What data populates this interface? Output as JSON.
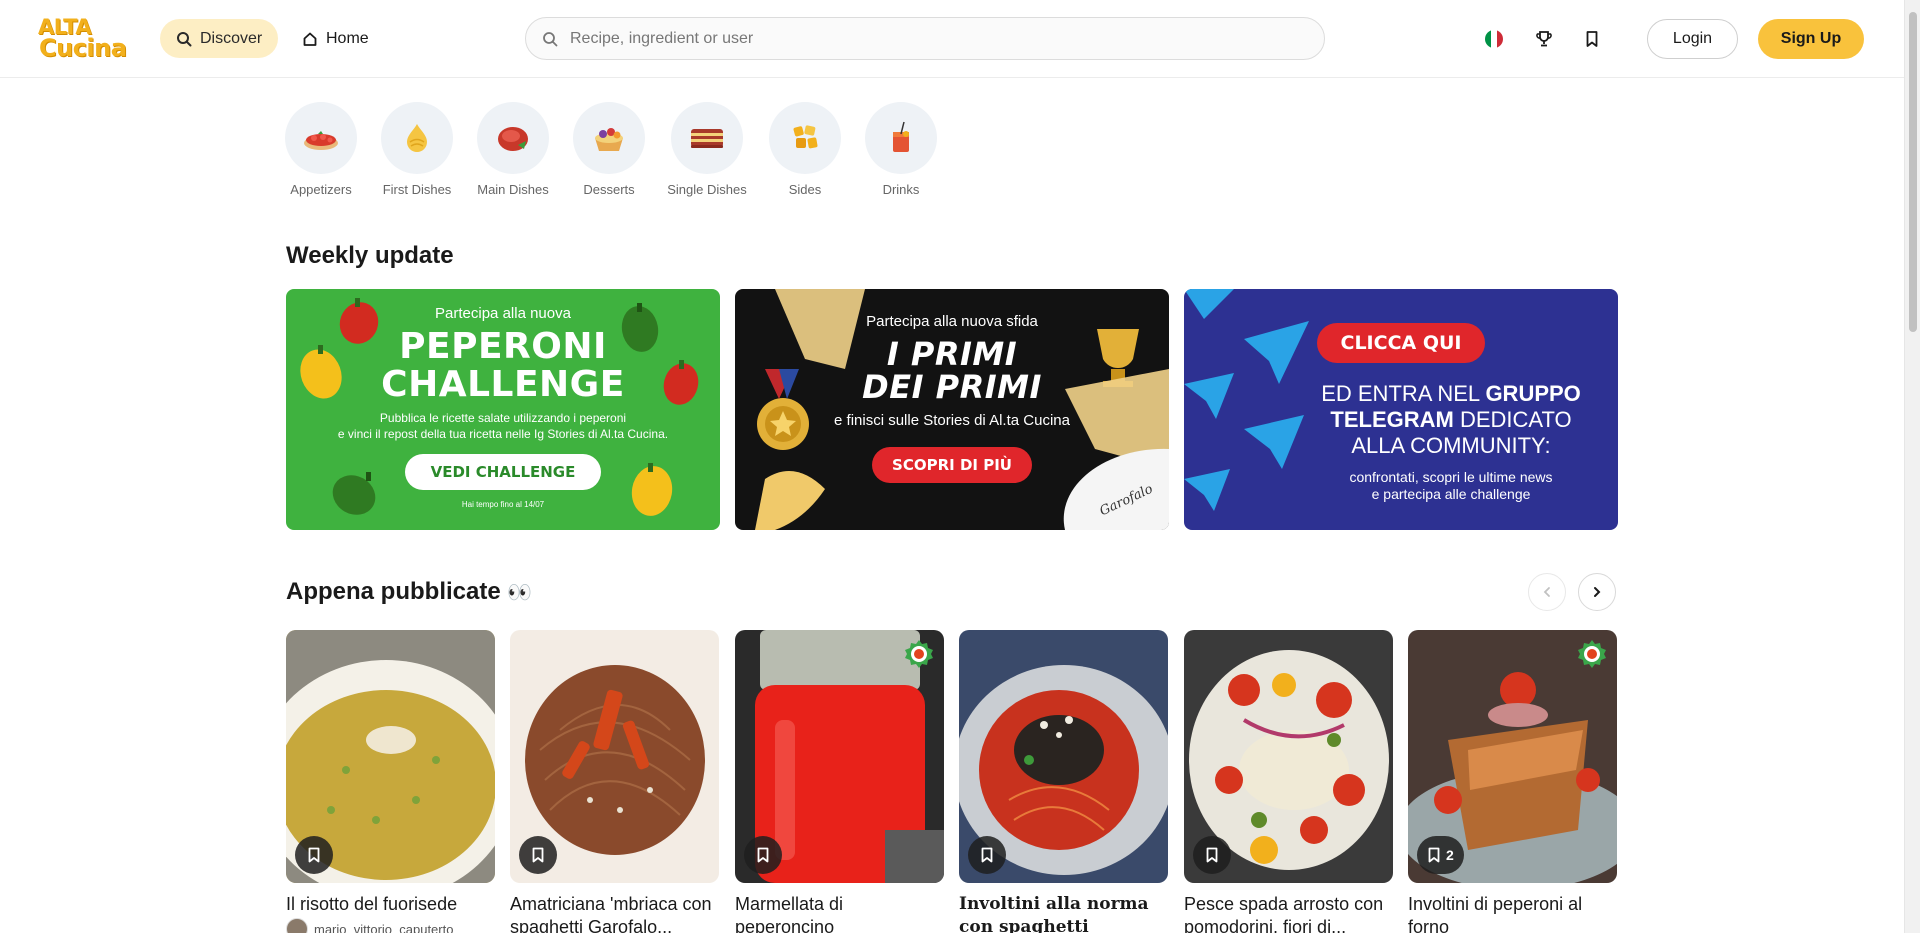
{
  "header": {
    "logo_line1": "ALTA",
    "logo_line2": "Cucina",
    "discover_label": "Discover",
    "home_label": "Home",
    "search_placeholder": "Recipe, ingredient or user",
    "login_label": "Login",
    "signup_label": "Sign Up",
    "colors": {
      "accent": "#f9c23c",
      "discover_bg": "#fdeec4"
    }
  },
  "categories": [
    {
      "label": "Appetizers",
      "icon": "bruschetta-icon"
    },
    {
      "label": "First Dishes",
      "icon": "pasta-icon"
    },
    {
      "label": "Main Dishes",
      "icon": "meat-icon"
    },
    {
      "label": "Desserts",
      "icon": "tart-icon"
    },
    {
      "label": "Single Dishes",
      "icon": "lasagna-icon"
    },
    {
      "label": "Sides",
      "icon": "fries-icon"
    },
    {
      "label": "Drinks",
      "icon": "cocktail-icon"
    }
  ],
  "weekly": {
    "title": "Weekly update",
    "banner1": {
      "line1": "Partecipa alla nuova",
      "line2": "PEPERONI",
      "line3": "CHALLENGE",
      "line4": "Pubblica le ricette salate utilizzando i peperoni",
      "line5": "e vinci il repost della tua ricetta nelle Ig Stories di Al.ta Cucina.",
      "button": "VEDI CHALLENGE",
      "footer": "Hai tempo fino al 14/07"
    },
    "banner2": {
      "line1": "Partecipa alla nuova sfida",
      "line2": "I PRIMI",
      "line3": "DEI PRIMI",
      "line4": "e finisci sulle Stories di Al.ta Cucina",
      "button": "SCOPRI DI PIÙ",
      "brand": "Garofalo"
    },
    "banner3": {
      "button": "CLICCA QUI",
      "line1a": "ED ENTRA NEL ",
      "line1b": "GRUPPO",
      "line2a": "TELEGRAM",
      "line2b": " DEDICATO",
      "line3": "ALLA COMMUNITY:",
      "line4": "confrontati, scopri le ultime news",
      "line5": "e partecipa alle challenge"
    }
  },
  "latest": {
    "title": "Appena pubblicate",
    "emoji": "👀",
    "recipes": [
      {
        "title": "Il risotto del fuorisede",
        "author": "mario_vittorio_caputerto",
        "bookmarks": "",
        "badge": false
      },
      {
        "title": "Amatriciana 'mbriaca con spaghetti Garofalo...",
        "author": "",
        "bookmarks": "",
        "badge": false
      },
      {
        "title": "Marmellata di peperoncino",
        "author": "",
        "bookmarks": "",
        "badge": true
      },
      {
        "title": "Involtini alla norma con spaghetti",
        "author": "",
        "bookmarks": "",
        "badge": false
      },
      {
        "title": "Pesce spada arrosto con pomodorini, fiori di...",
        "author": "",
        "bookmarks": "",
        "badge": false
      },
      {
        "title": "Involtini di peperoni al forno",
        "author": "",
        "bookmarks": "2",
        "badge": true
      }
    ]
  }
}
